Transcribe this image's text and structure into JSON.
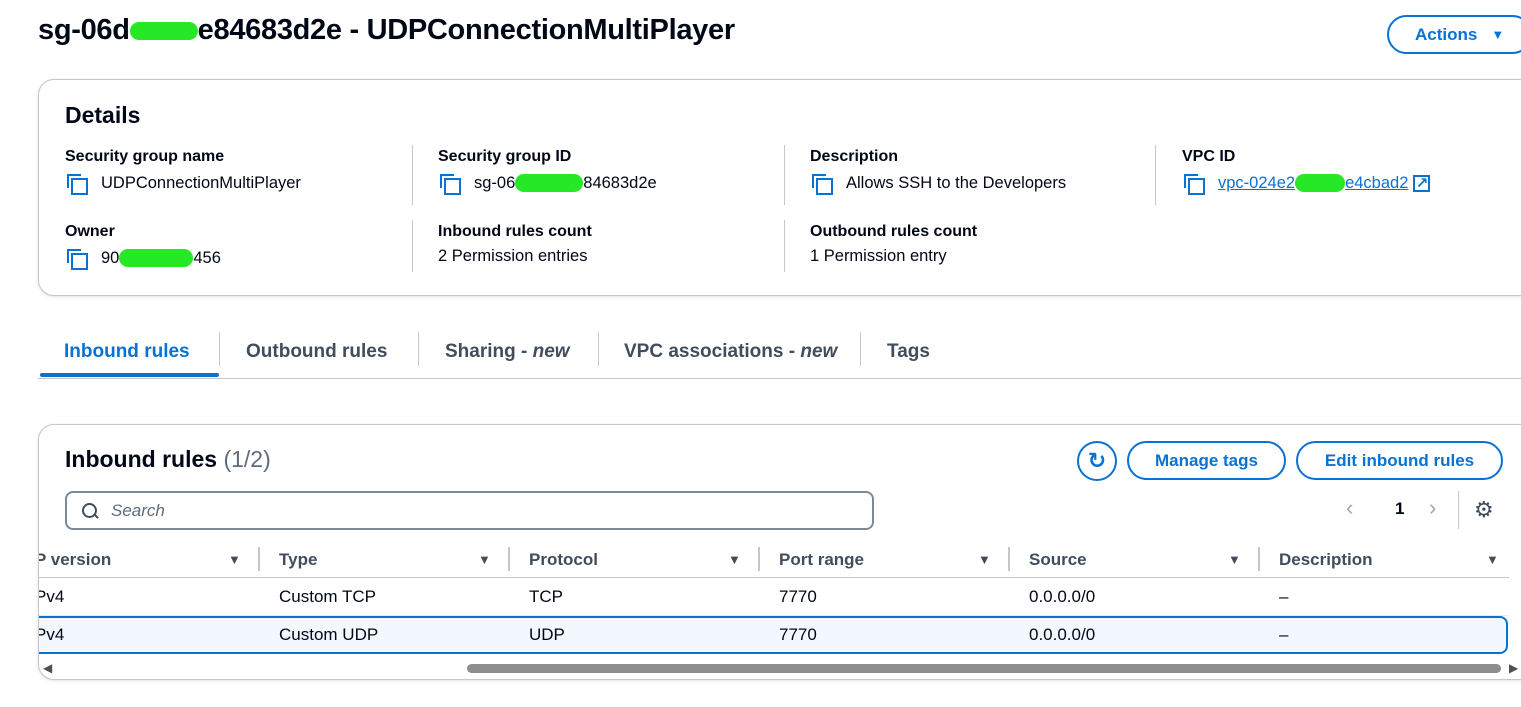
{
  "header": {
    "title_prefix": "sg-06d",
    "title_suffix": "e84683d2e - UDPConnectionMultiPlayer",
    "actions_label": "Actions",
    "actions_caret": "▼"
  },
  "details": {
    "heading": "Details",
    "security_group_name_label": "Security group name",
    "security_group_name": "UDPConnectionMultiPlayer",
    "security_group_id_label": "Security group ID",
    "security_group_id_prefix": "sg-06",
    "security_group_id_suffix": "84683d2e",
    "description_label": "Description",
    "description": "Allows SSH to the Developers",
    "vpc_id_label": "VPC ID",
    "vpc_id_prefix": "vpc-024e2",
    "vpc_id_suffix": "e4cbad2",
    "owner_label": "Owner",
    "owner_prefix": "90",
    "owner_suffix": "456",
    "inbound_count_label": "Inbound rules count",
    "inbound_count": "2 Permission entries",
    "outbound_count_label": "Outbound rules count",
    "outbound_count": "1 Permission entry"
  },
  "tabs": {
    "inbound": "Inbound rules",
    "outbound": "Outbound rules",
    "sharing": "Sharing - ",
    "sharing_new": "new",
    "vpc_assoc": "VPC associations - ",
    "vpc_assoc_new": "new",
    "tags": "Tags"
  },
  "rules": {
    "title": "Inbound rules",
    "count": "(1/2)",
    "manage_tags": "Manage tags",
    "edit_inbound": "Edit inbound rules",
    "search_placeholder": "Search",
    "page": "1",
    "columns": {
      "ip_version": "P version",
      "type": "Type",
      "protocol": "Protocol",
      "port_range": "Port range",
      "source": "Source",
      "description": "Description"
    },
    "rows": [
      {
        "ip_version": "Pv4",
        "type": "Custom TCP",
        "protocol": "TCP",
        "port_range": "7770",
        "source": "0.0.0.0/0",
        "description": "–"
      },
      {
        "ip_version": "Pv4",
        "type": "Custom UDP",
        "protocol": "UDP",
        "port_range": "7770",
        "source": "0.0.0.0/0",
        "description": "–"
      }
    ]
  },
  "icons": {
    "copy": "copy-icon",
    "external_link": "external-link-icon",
    "refresh": "refresh-icon",
    "search": "search-icon",
    "settings": "gear-icon",
    "prev": "chevron-left-icon",
    "next": "chevron-right-icon",
    "sort": "caret-down-icon"
  },
  "colors": {
    "accent": "#0972d3",
    "redaction": "#27e827",
    "selected_row_bg": "#f2f8fd"
  }
}
